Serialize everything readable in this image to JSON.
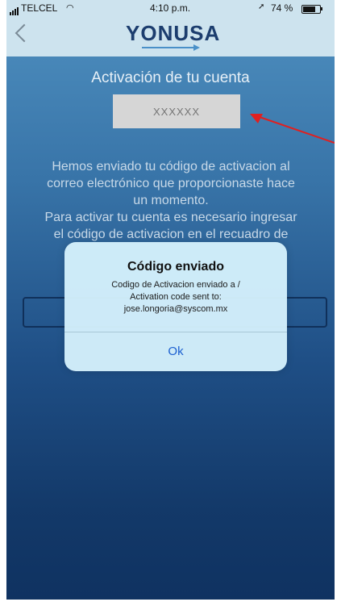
{
  "status_bar": {
    "carrier": "TELCEL",
    "time": "4:10 p.m.",
    "battery": "74 %"
  },
  "nav": {
    "logo_text": "YONUSA"
  },
  "page": {
    "title": "Activación de tu cuenta",
    "code_placeholder": "XXXXXX",
    "info_lines": [
      "Hemos enviado tu código de activacion al",
      "correo electrónico que proporcionaste hace",
      "un momento.",
      "Para activar tu cuenta es  necesario ingresar",
      "el código de activacion en el recuadro de"
    ]
  },
  "alert": {
    "title": "Código enviado",
    "message_lines": [
      "Codigo de Activacion enviado a /",
      "Activation code sent to:",
      "jose.longoria@syscom.mx"
    ],
    "ok_label": "Ok"
  },
  "colors": {
    "pointer_arrow": "#e02020",
    "alert_button": "#1b5fd0"
  }
}
